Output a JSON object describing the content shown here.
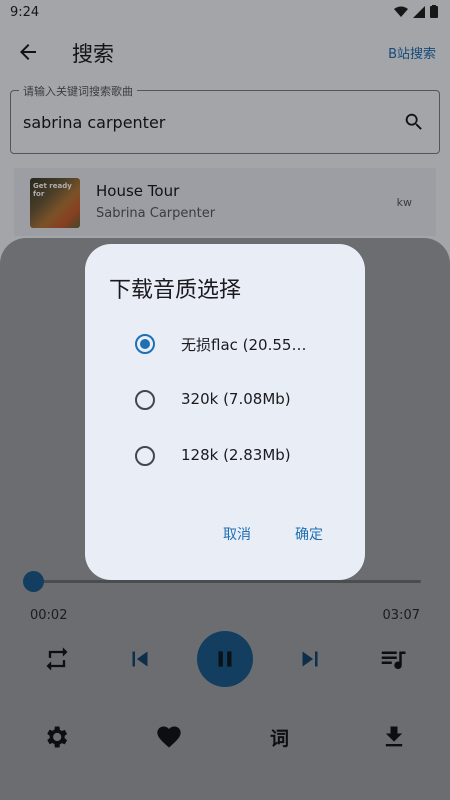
{
  "status_bar": {
    "time": "9:24"
  },
  "app_bar": {
    "title": "搜索",
    "bili_search": "B站搜索"
  },
  "search": {
    "label": "请输入关键词搜索歌曲",
    "value": "sabrina carpenter"
  },
  "song_row": {
    "cover_text": "Get ready for",
    "title": "House Tour",
    "artist": "Sabrina Carpenter",
    "source": "kw"
  },
  "player": {
    "current_time": "00:02",
    "total_time": "03:07",
    "progress": 0.01,
    "lyric_label": "词",
    "state": "playing"
  },
  "dialog": {
    "title": "下载音质选择",
    "options": [
      {
        "label": "无损flac (20.55…",
        "selected": true
      },
      {
        "label": "320k (7.08Mb)",
        "selected": false
      },
      {
        "label": "128k (2.83Mb)",
        "selected": false
      }
    ],
    "cancel": "取消",
    "confirm": "确定"
  },
  "colors": {
    "accent": "#1f6fb3",
    "play_button": "#1d5c8d",
    "dialog_bg": "#e9eef6"
  }
}
